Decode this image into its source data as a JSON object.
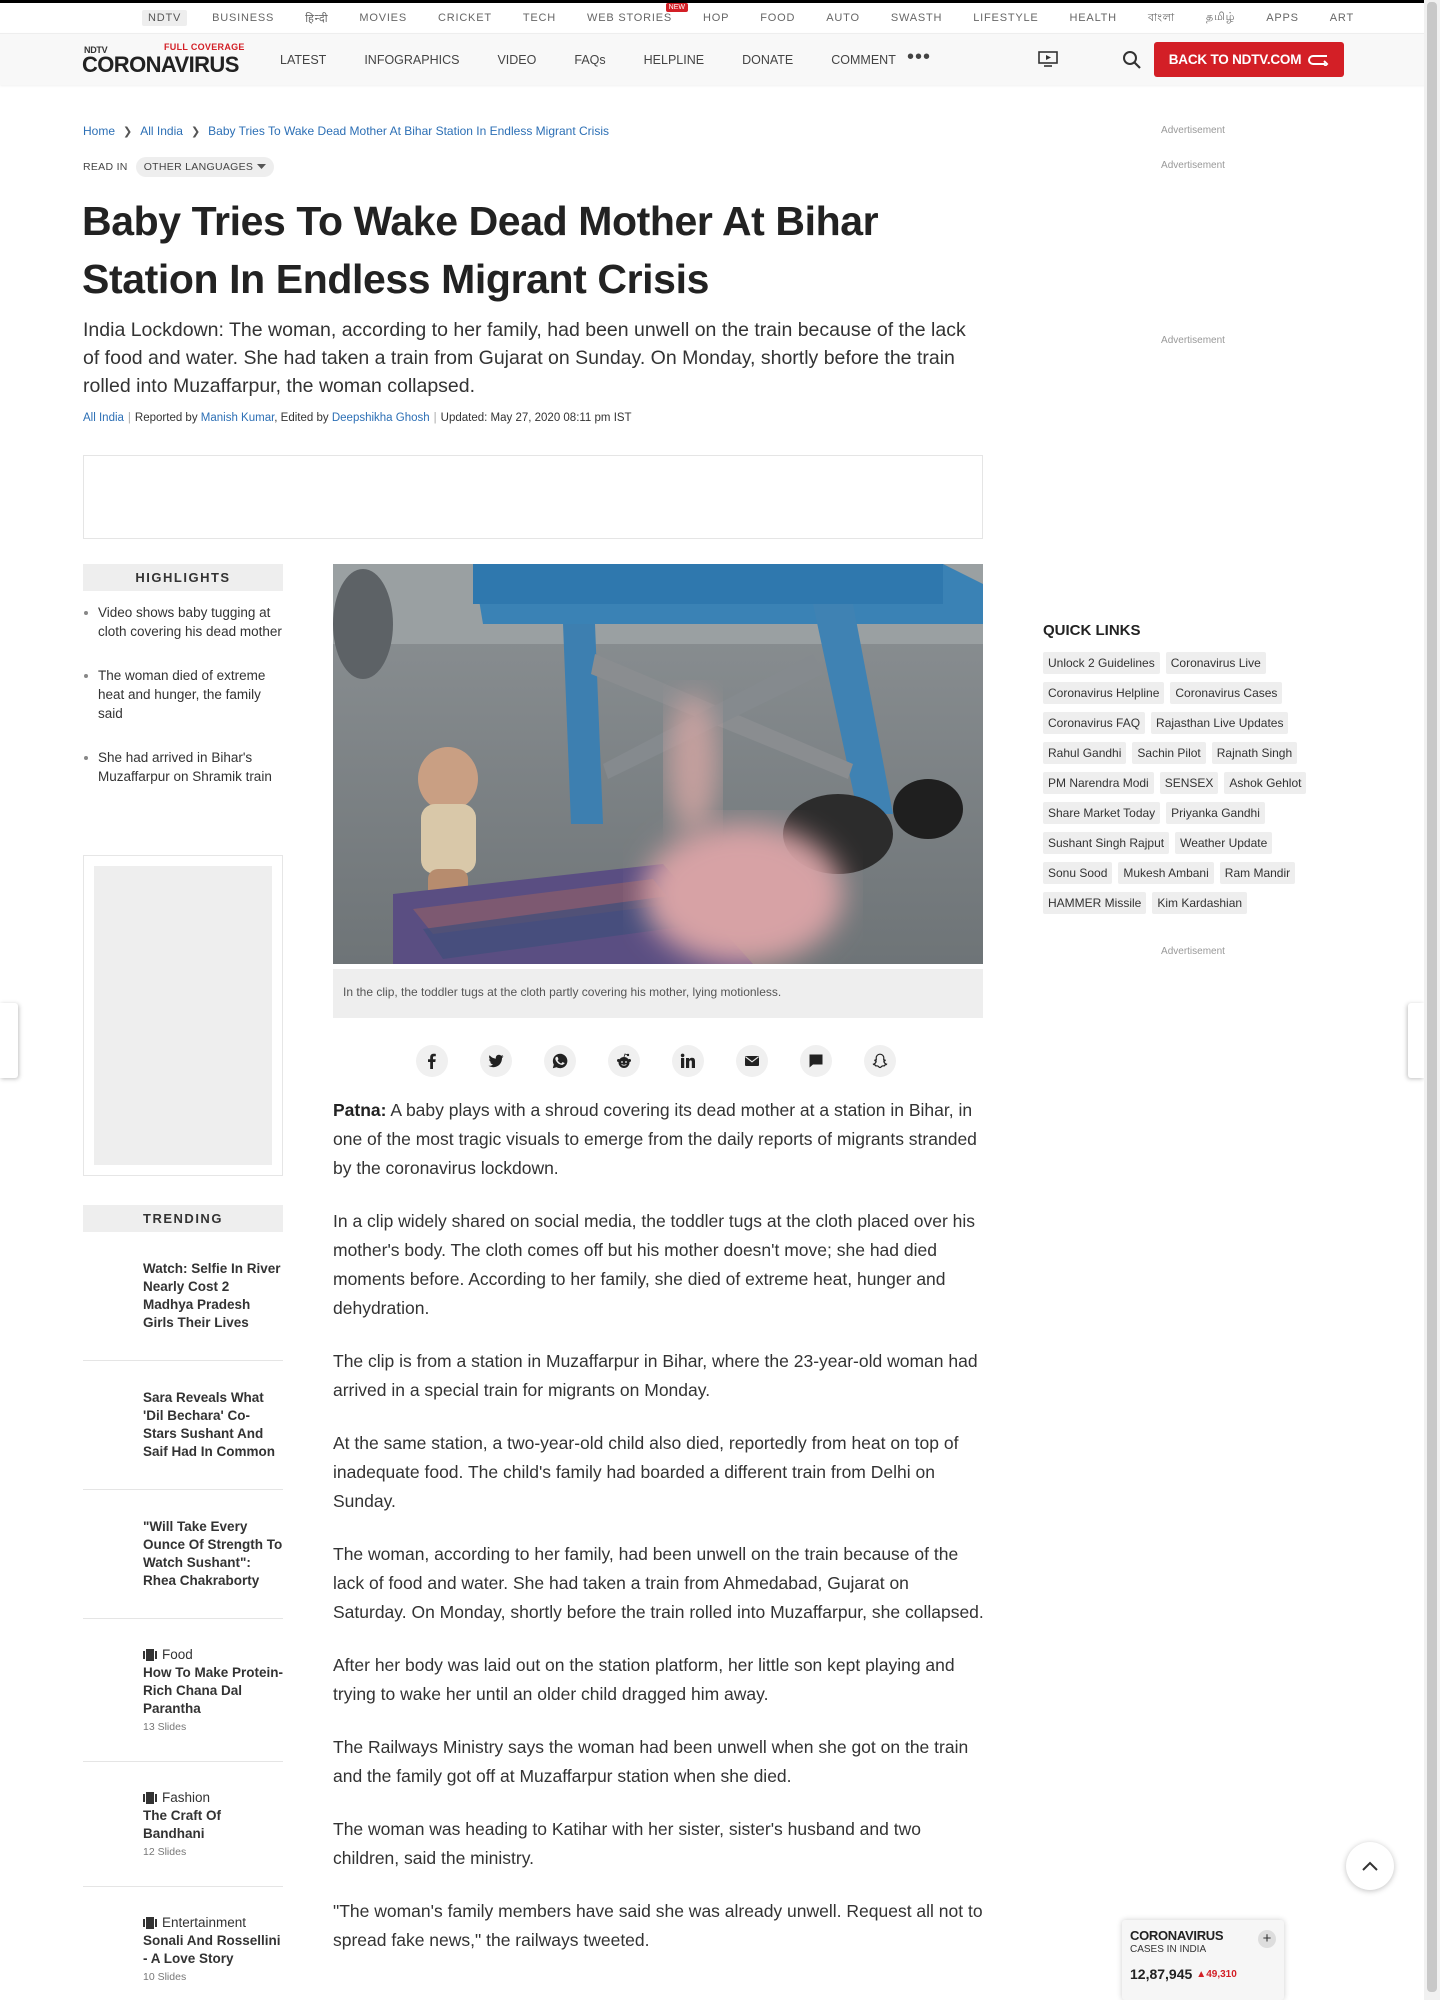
{
  "top_nav": {
    "items": [
      "NDTV",
      "BUSINESS",
      "हिन्दी",
      "MOVIES",
      "CRICKET",
      "TECH",
      "WEB STORIES",
      "HOP",
      "FOOD",
      "AUTO",
      "SWASTH",
      "LIFESTYLE",
      "HEALTH",
      "বাংলা",
      "தமிழ்",
      "APPS",
      "ART"
    ],
    "new_badge": "NEW"
  },
  "header": {
    "logo_small": "NDTV",
    "logo_tag": "FULL COVERAGE",
    "logo_main": "CORONAVIRUS",
    "nav": [
      "LATEST",
      "INFOGRAPHICS",
      "VIDEO",
      "FAQs",
      "HELPLINE",
      "DONATE",
      "COMMENT"
    ],
    "more": "•••",
    "back_button": "BACK TO NDTV.COM"
  },
  "breadcrumb": [
    "Home",
    "All India",
    "Baby Tries To Wake Dead Mother At Bihar Station In Endless Migrant Crisis"
  ],
  "read_in": {
    "label": "READ IN",
    "button": "OTHER LANGUAGES"
  },
  "article": {
    "headline": "Baby Tries To Wake Dead Mother At Bihar Station In Endless Migrant Crisis",
    "standfirst": "India Lockdown: The woman, according to her family, had been unwell on the train because of the lack of food and water. She had taken a train from Gujarat on Sunday. On Monday, shortly before the train rolled into Muzaffarpur, the woman collapsed.",
    "byline": {
      "section": "All India",
      "reported_label": "Reported by",
      "reporter": "Manish Kumar",
      "edited_label": ", Edited by",
      "editor": "Deepshikha Ghosh",
      "updated": "Updated: May 27, 2020 08:11 pm IST"
    },
    "image_caption": "In the clip, the toddler tugs at the cloth partly covering his mother, lying motionless.",
    "dateline": "Patna:",
    "paragraphs": [
      " A baby plays with a shroud covering its dead mother at a station in Bihar, in one of the most tragic visuals to emerge from the daily reports of migrants stranded by the coronavirus lockdown.",
      "In a clip widely shared on social media, the toddler tugs at the cloth placed over his mother's body. The cloth comes off but his mother doesn't move; she had died moments before. According to her family, she died of extreme heat, hunger and dehydration.",
      "The clip is from a station in Muzaffarpur in Bihar, where the 23-year-old woman had arrived in a special train for migrants on Monday.",
      "At the same station, a two-year-old child also died, reportedly from heat on top of inadequate food. The child's family had boarded a different train from Delhi on Sunday.",
      "The woman, according to her family, had been unwell on the train because of the lack of food and water. She had taken a train from Ahmedabad, Gujarat on Saturday. On Monday, shortly before the train rolled into Muzaffarpur, she collapsed.",
      "After her body was laid out on the station platform, her little son kept playing and trying to wake her until an older child dragged him away.",
      "The Railways Ministry says the woman had been unwell when she got on the train and the family got off at Muzaffarpur station when she died.",
      "The woman was heading to Katihar with her sister, sister's husband and two children, said the ministry.",
      "\"The woman's family members have said she was already unwell. Request all not to spread fake news,\" the railways tweeted."
    ]
  },
  "highlights": {
    "title": "HIGHLIGHTS",
    "items": [
      "Video shows baby tugging at cloth covering his dead mother",
      "The woman died of extreme heat and hunger, the family said",
      "She had arrived in Bihar's Muzaffarpur on Shramik train"
    ]
  },
  "trending": {
    "title": "TRENDING",
    "items": [
      {
        "title": "Watch: Selfie In River Nearly Cost 2 Madhya Pradesh Girls Their Lives"
      },
      {
        "title": "Sara Reveals What 'Dil Bechara' Co-Stars Sushant And Saif Had In Common"
      },
      {
        "title": "\"Will Take Every Ounce Of Strength To Watch Sushant\": Rhea Chakraborty"
      },
      {
        "category": "Food",
        "title": "How To Make Protein-Rich Chana Dal Parantha",
        "slides": "13 Slides"
      },
      {
        "category": "Fashion",
        "title": "The Craft Of Bandhani",
        "slides": "12 Slides"
      },
      {
        "category": "Entertainment",
        "title": "Sonali And Rossellini - A Love Story",
        "slides": "10 Slides"
      }
    ]
  },
  "share_icons": [
    "facebook-icon",
    "twitter-icon",
    "whatsapp-icon",
    "reddit-icon",
    "linkedin-icon",
    "email-icon",
    "comment-icon",
    "snapchat-icon"
  ],
  "right_rail": {
    "ad_label": "Advertisement",
    "quick_links_title": "QUICK LINKS",
    "quick_links": [
      "Unlock 2 Guidelines",
      "Coronavirus Live",
      "Coronavirus Helpline",
      "Coronavirus Cases",
      "Coronavirus FAQ",
      "Rajasthan Live Updates",
      "Rahul Gandhi",
      "Sachin Pilot",
      "Rajnath Singh",
      "PM Narendra Modi",
      "SENSEX",
      "Ashok Gehlot",
      "Share Market Today",
      "Priyanka Gandhi",
      "Sushant Singh Rajput",
      "Weather Update",
      "Sonu Sood",
      "Mukesh Ambani",
      "Ram Mandir",
      "HAMMER Missile",
      "Kim Kardashian"
    ]
  },
  "corona_widget": {
    "title": "CORONAVIRUS",
    "subtitle": "CASES IN INDIA",
    "count": "12,87,945",
    "delta": "49,310"
  },
  "colors": {
    "brand_red": "#d31f26",
    "link_blue": "#2c6fb5"
  }
}
